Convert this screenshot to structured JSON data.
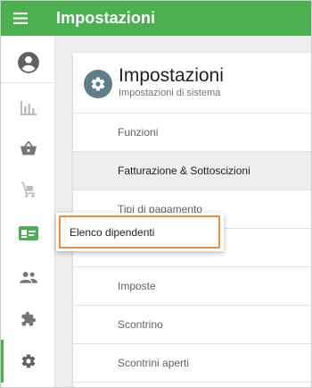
{
  "topbar": {
    "title": "Impostazioni",
    "background": "#4caf50"
  },
  "sidebar": {
    "items": [
      {
        "icon": "account-circle-icon"
      },
      {
        "icon": "bar-chart-icon"
      },
      {
        "icon": "basket-icon"
      },
      {
        "icon": "cart-icon"
      },
      {
        "icon": "employee-card-icon",
        "color": "#4caf50"
      },
      {
        "icon": "people-icon"
      },
      {
        "icon": "puzzle-icon"
      },
      {
        "icon": "gear-icon",
        "active": true
      }
    ]
  },
  "settings": {
    "title": "Impostazioni",
    "subtitle": "Impostazioni di sistema",
    "rows": [
      {
        "label": "Funzioni"
      },
      {
        "label": "Fatturazione & Sottoscizioni",
        "selected": true
      },
      {
        "label": "Tipi di pagamento"
      },
      {
        "label": ""
      },
      {
        "label": "Imposte"
      },
      {
        "label": "Scontrino"
      },
      {
        "label": "Scontrini aperti"
      }
    ]
  },
  "tooltip": {
    "label": "Elenco dipendenti",
    "highlight": "#ef8c3d"
  }
}
